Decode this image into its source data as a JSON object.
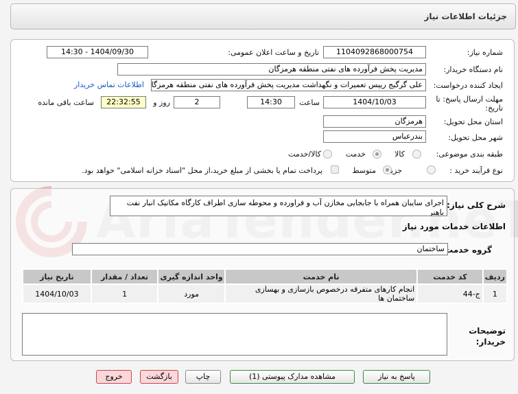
{
  "header": {
    "title": "جزئیات اطلاعات نیاز"
  },
  "form": {
    "need_number_label": "شماره نیاز:",
    "need_number": "1104092868000754",
    "announce_label": "تاریخ و ساعت اعلان عمومی:",
    "announce_value": "1404/09/30 - 14:30",
    "buyer_org_label": "نام دستگاه خریدار:",
    "buyer_org": "مدیریت پخش فرآورده های نفتی منطقه هرمزگان",
    "creator_label": "ایجاد کننده درخواست:",
    "creator": "علی گرگیج رییس تعمیرات و نگهداشت مدیریت پخش فرآورده های نفتی منطقه هرمزگان",
    "contact_link": "اطلاعات تماس خریدار",
    "deadline_label_line1": "مهلت ارسال پاسخ: تا",
    "deadline_label_line2": "تاریخ:",
    "deadline_date": "1404/10/03",
    "time_label": "ساعت",
    "deadline_time": "14:30",
    "days_value": "2",
    "days_label": "روز و",
    "remaining_time": "22:32:55",
    "remaining_label": "ساعت باقی مانده",
    "province_label": "استان محل تحویل:",
    "province": "هرمزگان",
    "city_label": "شهر محل تحویل:",
    "city": "بندرعباس",
    "category_label": "طبقه بندی موضوعی:",
    "category_options": [
      "کالا",
      "خدمت",
      "کالا/خدمت"
    ],
    "category_selected": "خدمت",
    "process_label": "نوع فرآیند خرید :",
    "process_options": [
      "جزیی",
      "متوسط"
    ],
    "process_selected": "متوسط",
    "payment_note": "پرداخت تمام یا بخشی از مبلغ خرید،از محل \"اسناد خزانه اسلامی\" خواهد بود."
  },
  "description": {
    "label": "شرح کلی نیاز:",
    "value": "اجرای سایبان همراه با جابجایی مخازن آب و فراورده و محوطه سازی اطراف کارگاه مکانیک انبار نفت باهنر"
  },
  "services": {
    "section_title": "اطلاعات خدمات مورد نیاز",
    "group_label": "گروه خدمت:",
    "group_value": "ساختمان",
    "columns": [
      "ردیف",
      "کد خدمت",
      "نام خدمت",
      "واحد اندازه گیری",
      "تعداد / مقدار",
      "تاریخ نیاز"
    ],
    "rows": [
      {
        "index": "1",
        "code": "ج-44",
        "name": "انجام کارهای متفرقه درخصوص بازسازی و بهسازی ساختمان ها",
        "unit": "مورد",
        "qty": "1",
        "date": "1404/10/03"
      }
    ]
  },
  "buyer_notes": {
    "label": "توضیحات خریدار:",
    "value": ""
  },
  "buttons": {
    "reply": "پاسخ به نیاز",
    "attachments": "مشاهده مدارک پیوستی (1)",
    "print": "چاپ",
    "back": "بازگشت",
    "exit": "خروج"
  },
  "colors": {
    "link": "#1a55c8",
    "header_text": "#333333",
    "watermark": "#d8d8d8",
    "watermark_logo": "#e8c0c0"
  },
  "watermark": {
    "text": "AriaTender.neT"
  }
}
